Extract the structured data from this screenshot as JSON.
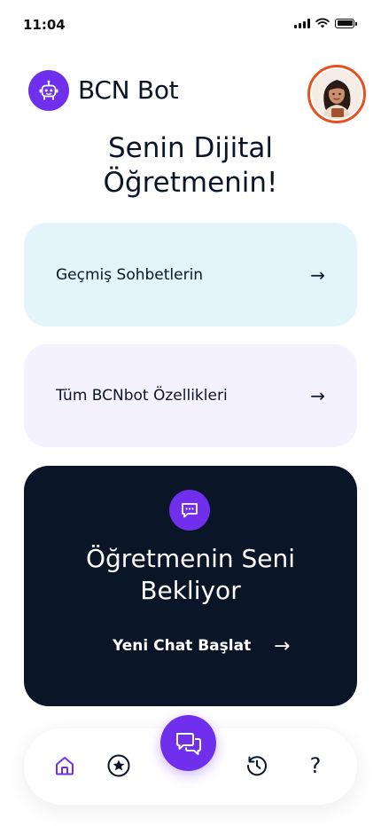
{
  "status_bar": {
    "time": "11:04",
    "icons": [
      "signal-icon",
      "wifi-icon",
      "battery-icon"
    ]
  },
  "header": {
    "logo_icon": "robot-icon",
    "title": "BCN Bot",
    "avatar_icon": "teacher-avatar"
  },
  "headline": {
    "line1": "Senin Dijital",
    "line2": "Öğretmenin!"
  },
  "cards": [
    {
      "label": "Geçmiş Sohbetlerin",
      "arrow": "→"
    },
    {
      "label": "Tüm BCNbot Özellikleri",
      "arrow": "→"
    }
  ],
  "hero": {
    "icon": "chat-bubble-icon",
    "title_line1": "Öğretmenin Seni",
    "title_line2": "Bekliyor",
    "cta": "Yeni Chat Başlat",
    "cta_arrow": "→"
  },
  "bottom_nav": {
    "items": [
      {
        "icon": "home-icon",
        "active": true
      },
      {
        "icon": "star-icon",
        "active": false
      },
      {
        "icon": "chat-icon",
        "active": false
      },
      {
        "icon": "history-icon",
        "active": false
      },
      {
        "icon": "help-icon",
        "label": "?",
        "active": false
      }
    ]
  },
  "colors": {
    "accent": "#6f2fed",
    "dark_card": "#0b1528",
    "history_card": "#e3f4fa",
    "features_card": "#f4f2ff",
    "avatar_ring": "#e8501e"
  }
}
